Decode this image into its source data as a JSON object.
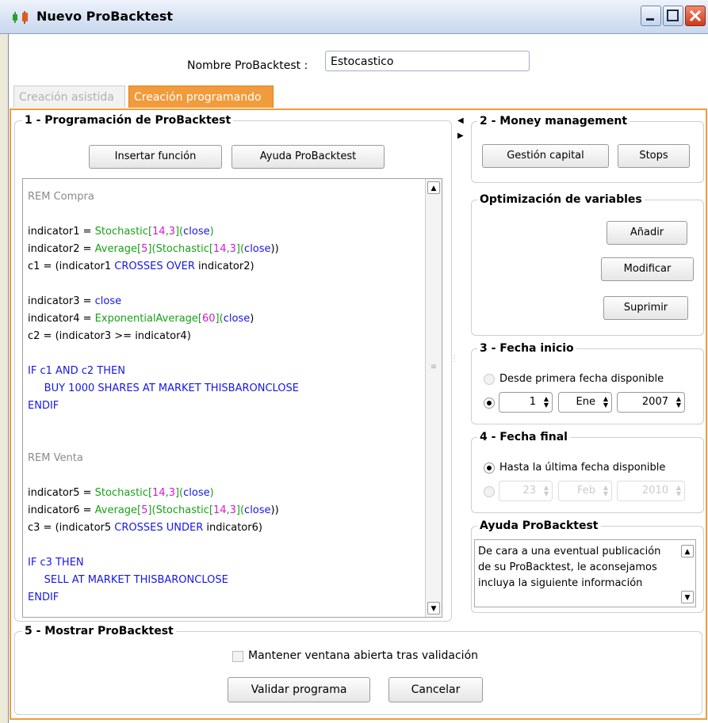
{
  "window": {
    "title": "Nuevo ProBacktest",
    "icon": "candlestick-icon"
  },
  "name_field": {
    "label": "Nombre ProBacktest :",
    "value": "Estocastico"
  },
  "tabs": [
    {
      "label": "Creación asistida"
    },
    {
      "label": "Creación programando"
    }
  ],
  "section1": {
    "title": "1 - Programación de ProBacktest",
    "insert_function_label": "Insertar función",
    "help_label": "Ayuda ProBacktest"
  },
  "code_lines": [
    [
      {
        "t": "REM Compra",
        "c": "gray"
      }
    ],
    [],
    [
      {
        "t": "indicator1 = ",
        "c": "black"
      },
      {
        "t": "Stochastic[",
        "c": "green"
      },
      {
        "t": "14",
        "c": "mag"
      },
      {
        "t": ",",
        "c": "green"
      },
      {
        "t": "3",
        "c": "mag"
      },
      {
        "t": "](",
        "c": "green"
      },
      {
        "t": "close",
        "c": "blue"
      },
      {
        "t": ")",
        "c": "green"
      }
    ],
    [
      {
        "t": "indicator2 = ",
        "c": "black"
      },
      {
        "t": "Average[",
        "c": "green"
      },
      {
        "t": "5",
        "c": "mag"
      },
      {
        "t": "](",
        "c": "green"
      },
      {
        "t": "Stochastic[",
        "c": "green"
      },
      {
        "t": "14",
        "c": "mag"
      },
      {
        "t": ",",
        "c": "green"
      },
      {
        "t": "3",
        "c": "mag"
      },
      {
        "t": "](",
        "c": "green"
      },
      {
        "t": "close",
        "c": "blue"
      },
      {
        "t": "))",
        "c": "black"
      }
    ],
    [
      {
        "t": "c1 = (indicator1 ",
        "c": "black"
      },
      {
        "t": "CROSSES OVER",
        "c": "blue"
      },
      {
        "t": " indicator2)",
        "c": "black"
      }
    ],
    [],
    [
      {
        "t": "indicator3 = ",
        "c": "black"
      },
      {
        "t": "close",
        "c": "blue"
      }
    ],
    [
      {
        "t": "indicator4 = ",
        "c": "black"
      },
      {
        "t": "ExponentialAverage[",
        "c": "green"
      },
      {
        "t": "60",
        "c": "mag"
      },
      {
        "t": "](",
        "c": "green"
      },
      {
        "t": "close",
        "c": "blue"
      },
      {
        "t": ")",
        "c": "black"
      }
    ],
    [
      {
        "t": "c2 = (indicator3 >= indicator4)",
        "c": "black"
      }
    ],
    [],
    [
      {
        "t": "IF c1 AND c2 THEN",
        "c": "blue"
      }
    ],
    [
      {
        "t": "     BUY 1000 SHARES AT MARKET THISBARONCLOSE",
        "c": "blue"
      }
    ],
    [
      {
        "t": "ENDIF",
        "c": "blue"
      }
    ],
    [],
    [],
    [
      {
        "t": "REM Venta",
        "c": "gray"
      }
    ],
    [],
    [
      {
        "t": "indicator5 = ",
        "c": "black"
      },
      {
        "t": "Stochastic[",
        "c": "green"
      },
      {
        "t": "14",
        "c": "mag"
      },
      {
        "t": ",",
        "c": "green"
      },
      {
        "t": "3",
        "c": "mag"
      },
      {
        "t": "](",
        "c": "green"
      },
      {
        "t": "close",
        "c": "blue"
      },
      {
        "t": ")",
        "c": "green"
      }
    ],
    [
      {
        "t": "indicator6 = ",
        "c": "black"
      },
      {
        "t": "Average[",
        "c": "green"
      },
      {
        "t": "5",
        "c": "mag"
      },
      {
        "t": "](",
        "c": "green"
      },
      {
        "t": "Stochastic[",
        "c": "green"
      },
      {
        "t": "14",
        "c": "mag"
      },
      {
        "t": ",",
        "c": "green"
      },
      {
        "t": "3",
        "c": "mag"
      },
      {
        "t": "](",
        "c": "green"
      },
      {
        "t": "close",
        "c": "blue"
      },
      {
        "t": "))",
        "c": "black"
      }
    ],
    [
      {
        "t": "c3 = (indicator5 ",
        "c": "black"
      },
      {
        "t": "CROSSES UNDER",
        "c": "blue"
      },
      {
        "t": " indicator6)",
        "c": "black"
      }
    ],
    [],
    [
      {
        "t": "IF c3 THEN",
        "c": "blue"
      }
    ],
    [
      {
        "t": "     SELL AT MARKET THISBARONCLOSE",
        "c": "blue"
      }
    ],
    [
      {
        "t": "ENDIF",
        "c": "blue"
      }
    ]
  ],
  "section2": {
    "title": "2 - Money management",
    "capital_label": "Gestión capital",
    "stops_label": "Stops"
  },
  "optimization": {
    "title": "Optimización de variables",
    "add_label": "Añadir",
    "modify_label": "Modificar",
    "delete_label": "Suprimir"
  },
  "section3": {
    "title": "3 - Fecha inicio",
    "first_date_label": "Desde primera fecha disponible",
    "day": "1",
    "month": "Ene",
    "year": "2007"
  },
  "section4": {
    "title": "4 - Fecha final",
    "last_date_label": "Hasta la última fecha disponible",
    "day": "23",
    "month": "Feb",
    "year": "2010"
  },
  "help_panel": {
    "title": "Ayuda ProBacktest",
    "text": "De cara a una eventual publicación de su ProBacktest, le aconsejamos incluya la siguiente información"
  },
  "section5": {
    "title": "5 - Mostrar ProBacktest",
    "keep_open_label": "Mantener ventana abierta tras validación",
    "validate_label": "Validar programa",
    "cancel_label": "Cancelar"
  },
  "colors": {
    "accent": "#f29b3c",
    "code_green": "#16a316",
    "code_magenta": "#d21ad2",
    "code_blue": "#1717e6"
  }
}
